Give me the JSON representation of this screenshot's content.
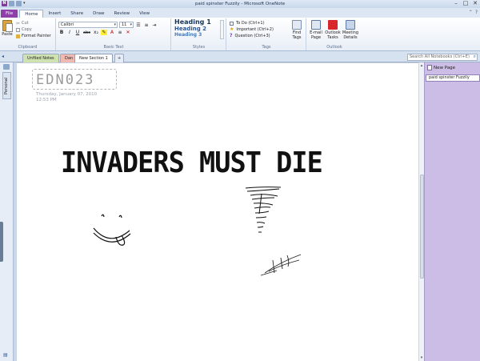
{
  "window": {
    "title": "paid spinster Fuzzily - Microsoft OneNote",
    "app_icon_letter": "N",
    "controls": [
      "–",
      "□",
      "✕"
    ]
  },
  "ribbon_tabs": [
    "File",
    "Home",
    "Insert",
    "Share",
    "Draw",
    "Review",
    "View"
  ],
  "clipboard": {
    "paste": "Paste",
    "cut": "Cut",
    "copy": "Copy",
    "format_painter": "Format Painter",
    "label": "Clipboard"
  },
  "basic_text": {
    "font": "Calibri",
    "size": "11",
    "label": "Basic Text",
    "buttons": [
      "B",
      "I",
      "U",
      "abc",
      "x₂",
      "A",
      "≡",
      "✕"
    ]
  },
  "styles": {
    "items": [
      "Heading 1",
      "Heading 2",
      "Heading 3"
    ],
    "label": "Styles"
  },
  "tags": {
    "items": [
      "To Do (Ctrl+1)",
      "Important (Ctrl+2)",
      "Question (Ctrl+3)"
    ],
    "find": "Find Tags",
    "label": "Tags"
  },
  "outlook": {
    "email": "E-mail Page",
    "tasks": "Outlook Tasks",
    "meeting": "Meeting Details",
    "label": "Outlook"
  },
  "sections": {
    "tabs": [
      "Unfiled Notes",
      "Dan",
      "New Section 1"
    ],
    "add": "+",
    "search_placeholder": "Search All Notebooks (Ctrl+E)"
  },
  "notebook_rail": {
    "notebook": "Personal"
  },
  "page": {
    "title": "EDN023",
    "date": "Thursday, January 07, 2010",
    "time": "12:53 PM",
    "ink_text": "INVADERS MUST DIE"
  },
  "pages_pane": {
    "new_page": "New Page",
    "items": [
      "paid spinster Fuzzily"
    ]
  },
  "colors": {
    "file_tab": "#8e3fa8",
    "page_pane": "#cbbde6",
    "heading_blue": "#17365d"
  }
}
